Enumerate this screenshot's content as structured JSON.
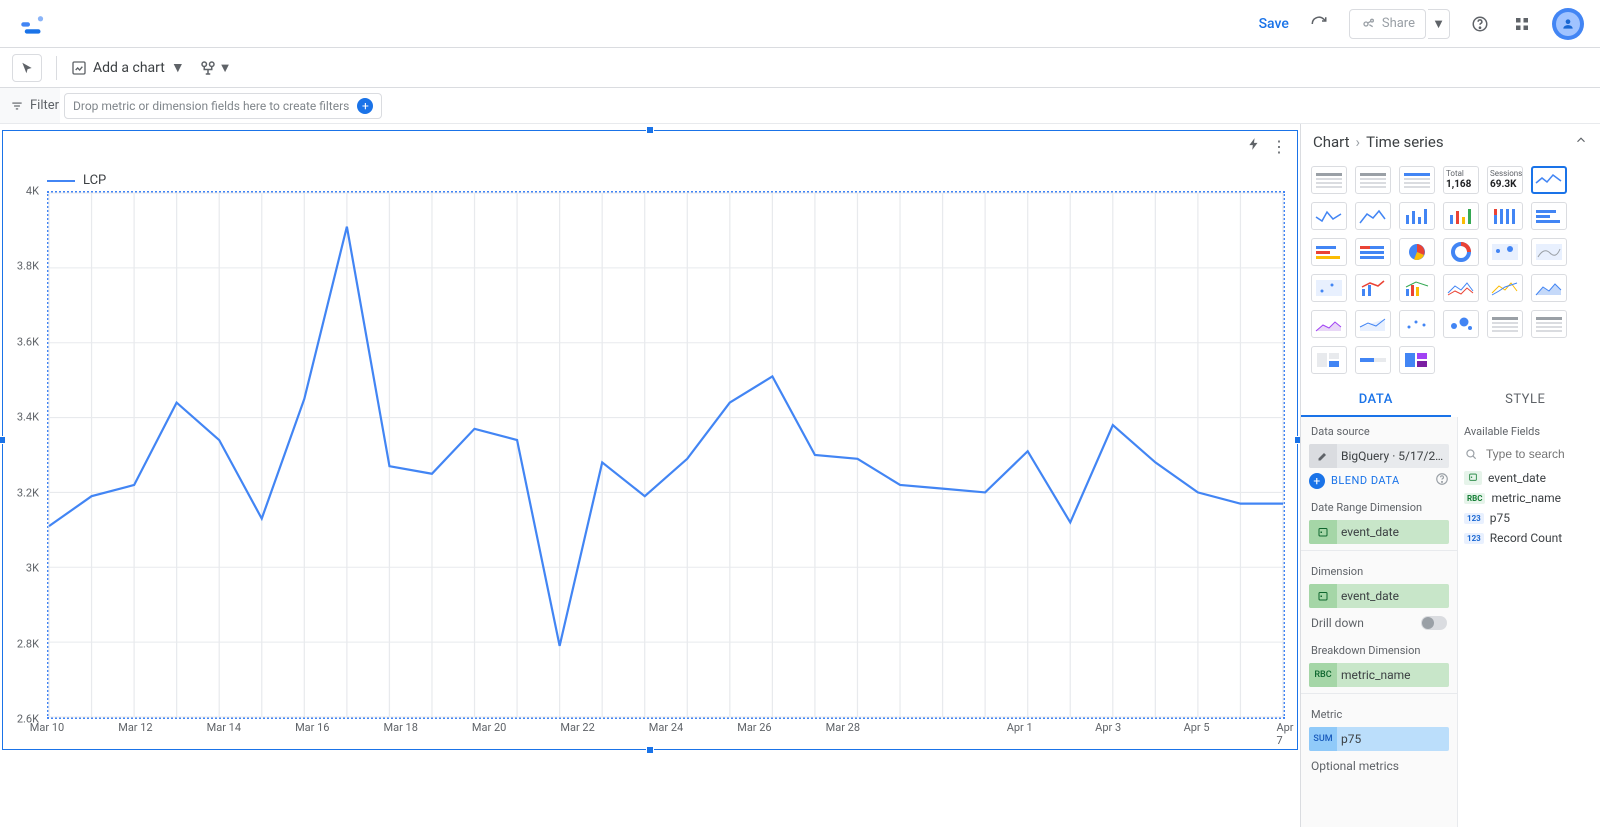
{
  "colors": {
    "accent": "#1a73e8",
    "series": "#4285f4"
  },
  "topbar": {
    "save_label": "Save",
    "share_label": "Share"
  },
  "toolbar": {
    "add_chart_label": "Add a chart"
  },
  "filter": {
    "label": "Filter",
    "placeholder": "Drop metric or dimension fields here to create filters"
  },
  "chart_toolbar": {
    "bolt": "⚡",
    "more": "⋮"
  },
  "chart_header": {
    "crumb_root": "Chart",
    "crumb_leaf": "Time series"
  },
  "chart_picker_stats": [
    {
      "label": "Total",
      "value": "1,168"
    },
    {
      "label": "Sessions",
      "value": "69.3K"
    }
  ],
  "tabs": {
    "data": "DATA",
    "style": "STYLE"
  },
  "panel": {
    "data_source_title": "Data source",
    "data_source_value": "BigQuery · 5/17/2…",
    "blend_label": "BLEND DATA",
    "date_range_title": "Date Range Dimension",
    "date_range_chip": "event_date",
    "dimension_title": "Dimension",
    "dimension_chip": "event_date",
    "drilldown_label": "Drill down",
    "breakdown_title": "Breakdown Dimension",
    "breakdown_chip": "metric_name",
    "metric_title": "Metric",
    "metric_chip": "p75",
    "optional_metrics_label": "Optional metrics",
    "available_fields_title": "Available Fields",
    "available_fields_placeholder": "Type to search",
    "fields": [
      {
        "badge": "date",
        "label": "event_date"
      },
      {
        "badge": "abc",
        "label": "metric_name"
      },
      {
        "badge": "123",
        "label": "p75"
      },
      {
        "badge": "123",
        "label": "Record Count"
      }
    ]
  },
  "chart_data": {
    "type": "line",
    "title": "",
    "legend": "LCP",
    "xlabel": "",
    "ylabel": "",
    "ylim": [
      2600,
      4000
    ],
    "y_ticks": [
      4000,
      3800,
      3600,
      3400,
      3200,
      3000,
      2800,
      2600
    ],
    "y_tick_labels": [
      "4K",
      "3.8K",
      "3.6K",
      "3.4K",
      "3.2K",
      "3K",
      "2.8K",
      "2.6K"
    ],
    "x_tick_labels": [
      "Mar 10",
      "Mar 12",
      "Mar 14",
      "Mar 16",
      "Mar 18",
      "Mar 20",
      "Mar 22",
      "Mar 24",
      "Mar 26",
      "Mar 28",
      "",
      "Apr 1",
      "Apr 3",
      "Apr 5",
      "Apr 7"
    ],
    "series": [
      {
        "name": "LCP",
        "values": [
          3110,
          3190,
          3220,
          3440,
          3340,
          3130,
          3450,
          3910,
          3270,
          3250,
          3370,
          3340,
          2790,
          3280,
          3190,
          3290,
          3440,
          3510,
          3300,
          3290,
          3220,
          3210,
          3200,
          3310,
          3120,
          3380,
          3280,
          3200,
          3170,
          3170
        ]
      }
    ]
  }
}
